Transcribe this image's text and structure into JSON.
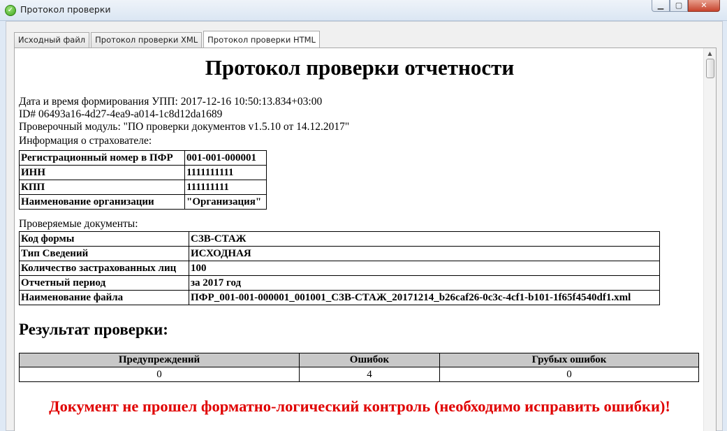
{
  "window": {
    "title": "Протокол проверки"
  },
  "tabs": [
    {
      "label": "Исходный файл"
    },
    {
      "label": "Протокол проверки XML"
    },
    {
      "label": "Протокол проверки HTML"
    }
  ],
  "document": {
    "title": "Протокол проверки отчетности",
    "meta": {
      "datetime": "Дата и время формирования УПП: 2017-12-16 10:50:13.834+03:00",
      "id": "ID# 06493a16-4d27-4ea9-a014-1c8d12da1689",
      "module": "Проверочный модуль: \"ПО проверки документов v1.5.10 от 14.12.2017\""
    },
    "insurer": {
      "caption": "Информация о страхователе:",
      "rows": [
        {
          "key": "Регистрационный номер в ПФР",
          "value": "001-001-000001"
        },
        {
          "key": "ИНН",
          "value": "1111111111"
        },
        {
          "key": "КПП",
          "value": "111111111"
        },
        {
          "key": "Наименование организации",
          "value": "\"Организация\""
        }
      ]
    },
    "documents": {
      "caption": "Проверяемые документы:",
      "rows": [
        {
          "key": "Код формы",
          "value": "СЗВ-СТАЖ"
        },
        {
          "key": "Тип Сведений",
          "value": "ИСХОДНАЯ"
        },
        {
          "key": "Количество застрахованных лиц",
          "value": "100"
        },
        {
          "key": "Отчетный период",
          "value": "за 2017 год"
        },
        {
          "key": "Наименование файла",
          "value": "ПФР_001-001-000001_001001_СЗВ-СТАЖ_20171214_b26caf26-0c3c-4cf1-b101-1f65f4540df1.xml"
        }
      ]
    },
    "result": {
      "heading": "Результат проверки:",
      "headers": [
        "Предупреждений",
        "Ошибок",
        "Грубых ошибок"
      ],
      "values": [
        "0",
        "4",
        "0"
      ]
    },
    "status_message": "Документ не прошел форматно-логический контроль (необходимо исправить ошибки)!",
    "status_color": "#e00000"
  }
}
